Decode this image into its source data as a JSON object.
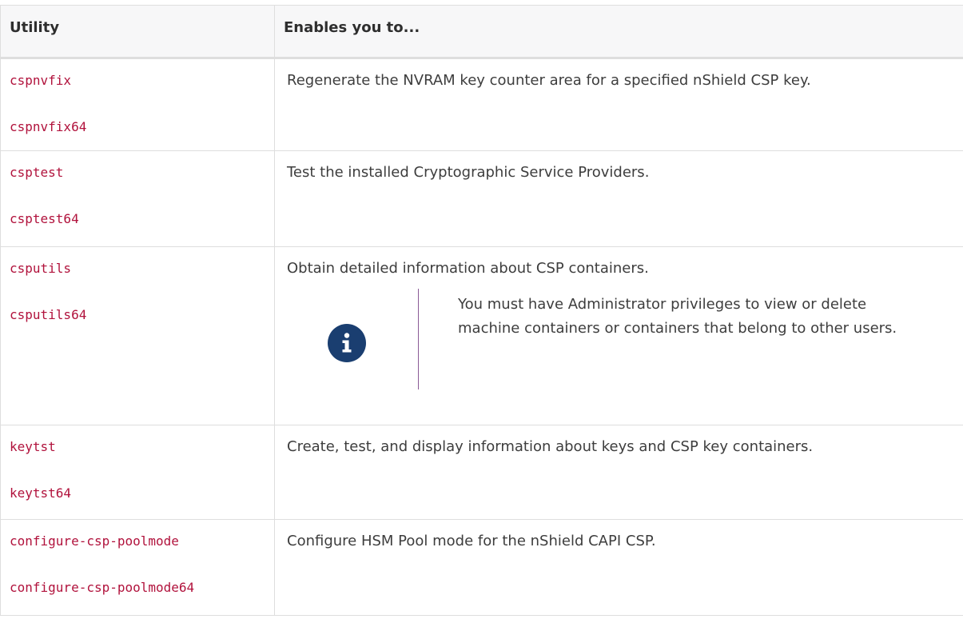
{
  "table": {
    "headers": {
      "utility": "Utility",
      "enables": "Enables you to..."
    },
    "rows": [
      {
        "utilities": [
          "cspnvfix",
          "cspnvfix64"
        ],
        "description": "Regenerate the NVRAM key counter area for a specified nShield CSP key."
      },
      {
        "utilities": [
          "csptest",
          "csptest64"
        ],
        "description": "Test the installed Cryptographic Service Providers."
      },
      {
        "utilities": [
          "csputils",
          "csputils64"
        ],
        "description": "Obtain detailed information about CSP containers.",
        "note": {
          "icon": "info-icon",
          "text": "You must have Administrator privileges to view or delete machine containers or containers that belong to other users."
        }
      },
      {
        "utilities": [
          "keytst",
          "keytst64"
        ],
        "description": "Create, test, and display information about keys and CSP key containers."
      },
      {
        "utilities": [
          "configure-csp-poolmode",
          "configure-csp-poolmode64"
        ],
        "description": "Configure HSM Pool mode for the nShield CAPI CSP."
      }
    ]
  },
  "colors": {
    "code": "#b1123c",
    "header_bg": "#f7f7f8",
    "border": "#dedede",
    "note_icon_bg": "#1a3e70",
    "note_bar": "#8a5a96",
    "text": "#3d3d3d"
  }
}
